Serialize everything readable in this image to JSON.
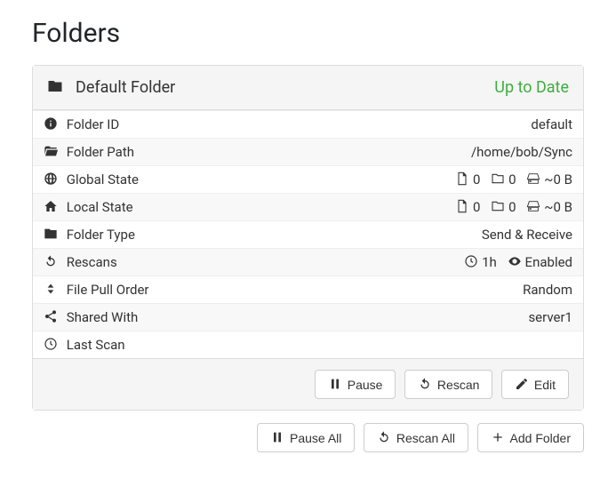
{
  "title": "Folders",
  "folder": {
    "name": "Default Folder",
    "status": "Up to Date",
    "rows": {
      "folder_id": {
        "label": "Folder ID",
        "value": "default"
      },
      "folder_path": {
        "label": "Folder Path",
        "value": "/home/bob/Sync"
      },
      "global_state": {
        "label": "Global State",
        "files": "0",
        "dirs": "0",
        "bytes": "~0 B"
      },
      "local_state": {
        "label": "Local State",
        "files": "0",
        "dirs": "0",
        "bytes": "~0 B"
      },
      "folder_type": {
        "label": "Folder Type",
        "value": "Send & Receive"
      },
      "rescans": {
        "label": "Rescans",
        "interval": "1h",
        "watch": "Enabled"
      },
      "file_pull_order": {
        "label": "File Pull Order",
        "value": "Random"
      },
      "shared_with": {
        "label": "Shared With",
        "value": "server1"
      },
      "last_scan": {
        "label": "Last Scan",
        "value": ""
      }
    },
    "buttons": {
      "pause": "Pause",
      "rescan": "Rescan",
      "edit": "Edit"
    }
  },
  "global_buttons": {
    "pause_all": "Pause All",
    "rescan_all": "Rescan All",
    "add_folder": "Add Folder"
  }
}
